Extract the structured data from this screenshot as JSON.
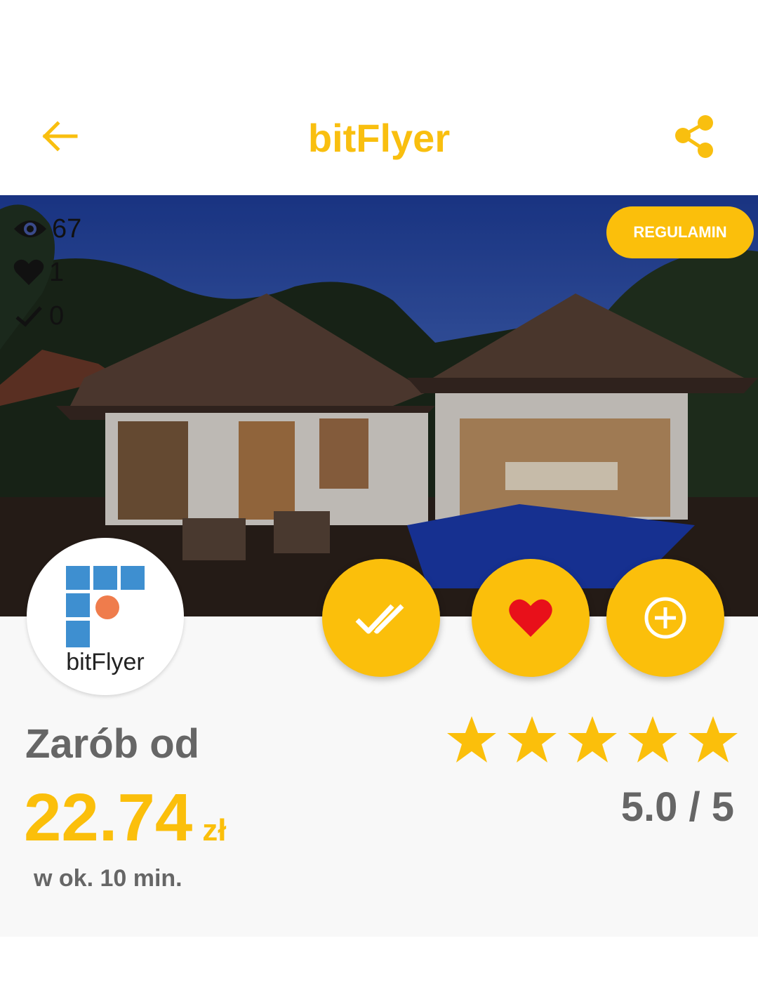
{
  "header": {
    "title": "bitFlyer",
    "back_icon": "arrow-left-icon",
    "share_icon": "share-icon"
  },
  "stats": {
    "views": "67",
    "likes": "1",
    "completed": "0"
  },
  "hero": {
    "terms_label": "REGULAMIN"
  },
  "logo": {
    "text": "bitFlyer"
  },
  "actions": {
    "check_icon": "check-icon",
    "heart_icon": "heart-icon",
    "add_icon": "plus-circle-icon"
  },
  "offer": {
    "label": "Zarób od",
    "amount": "22.74",
    "currency": "zł",
    "time": "w ok. 10 min."
  },
  "rating": {
    "text": "5.0 / 5",
    "stars": 5
  },
  "colors": {
    "accent": "#fbbf0b",
    "heart": "#e8101a",
    "text_gray": "#666666"
  }
}
